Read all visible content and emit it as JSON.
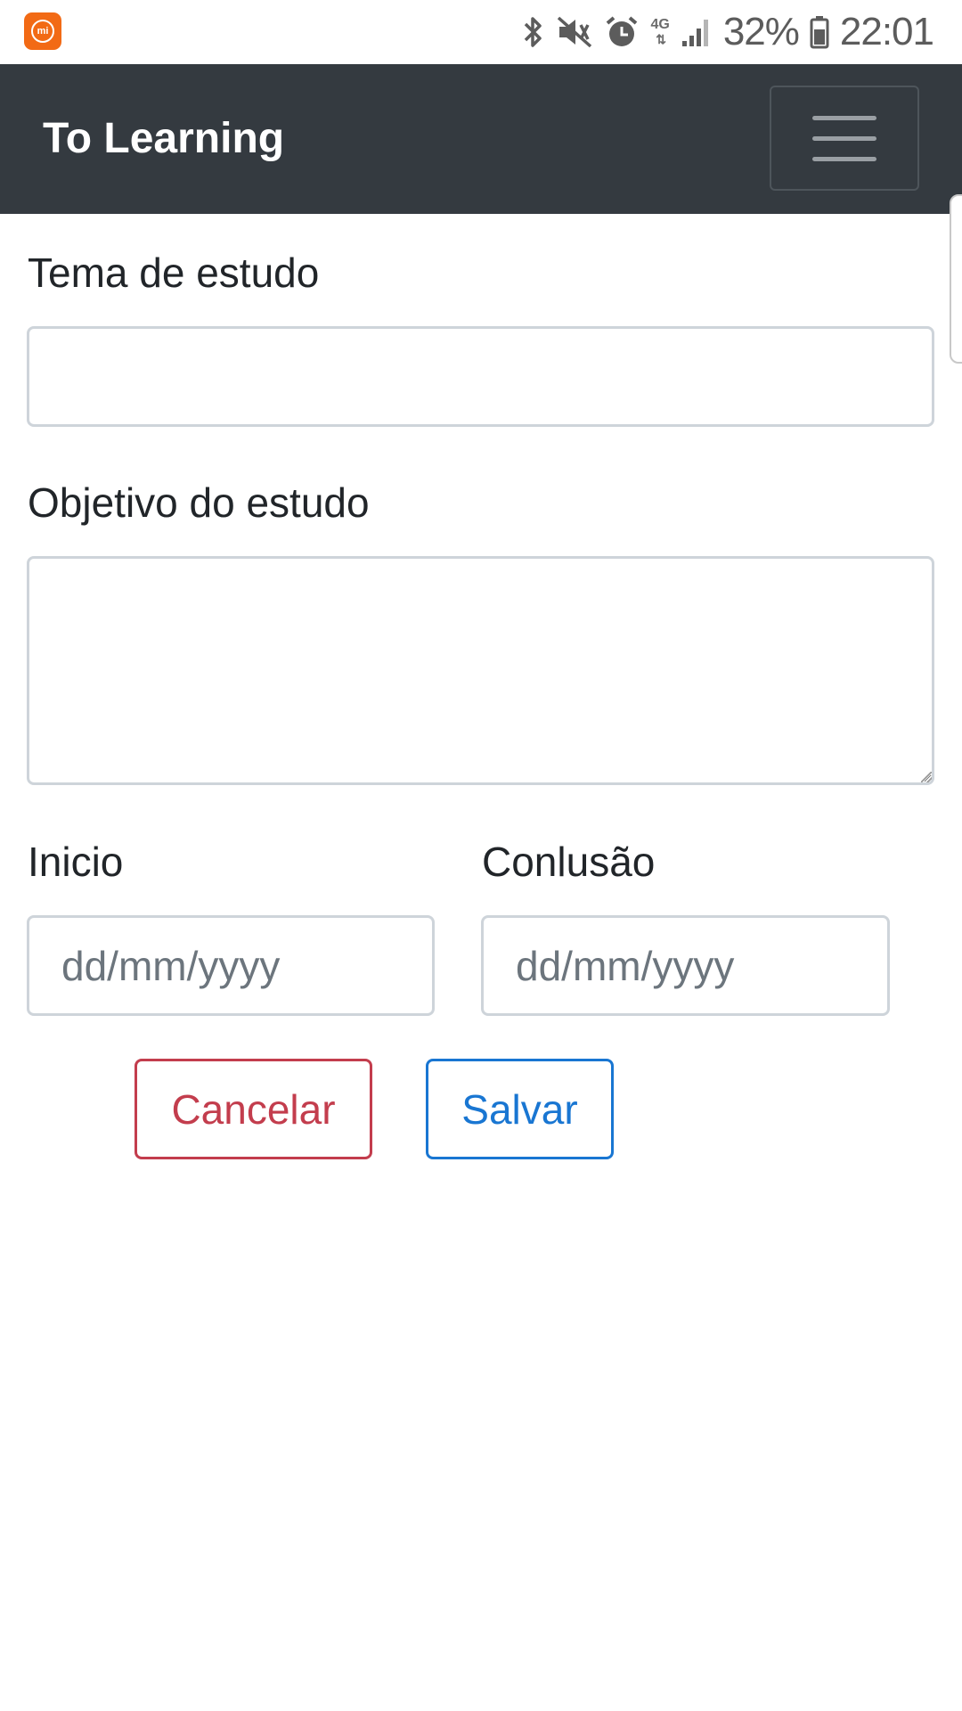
{
  "status_bar": {
    "battery_percent": "32%",
    "time": "22:01",
    "network_type": "4G",
    "icons": [
      "mi-app-icon",
      "bluetooth-icon",
      "vibrate-mute-icon",
      "alarm-icon",
      "network-4g-icon",
      "signal-icon",
      "battery-icon"
    ]
  },
  "navbar": {
    "brand": "To Learning",
    "toggle_icon": "hamburger-menu-icon"
  },
  "form": {
    "topic_label": "Tema de estudo",
    "topic_value": "",
    "objective_label": "Objetivo do estudo",
    "objective_value": "",
    "start_label": "Inicio",
    "start_placeholder": "dd/mm/yyyy",
    "end_label": "Conlusão",
    "end_placeholder": "dd/mm/yyyy",
    "cancel_label": "Cancelar",
    "save_label": "Salvar"
  },
  "colors": {
    "navbar_bg": "#343a40",
    "cancel": "#c33d4d",
    "save": "#1976d2",
    "mi_orange": "#f26a15"
  }
}
